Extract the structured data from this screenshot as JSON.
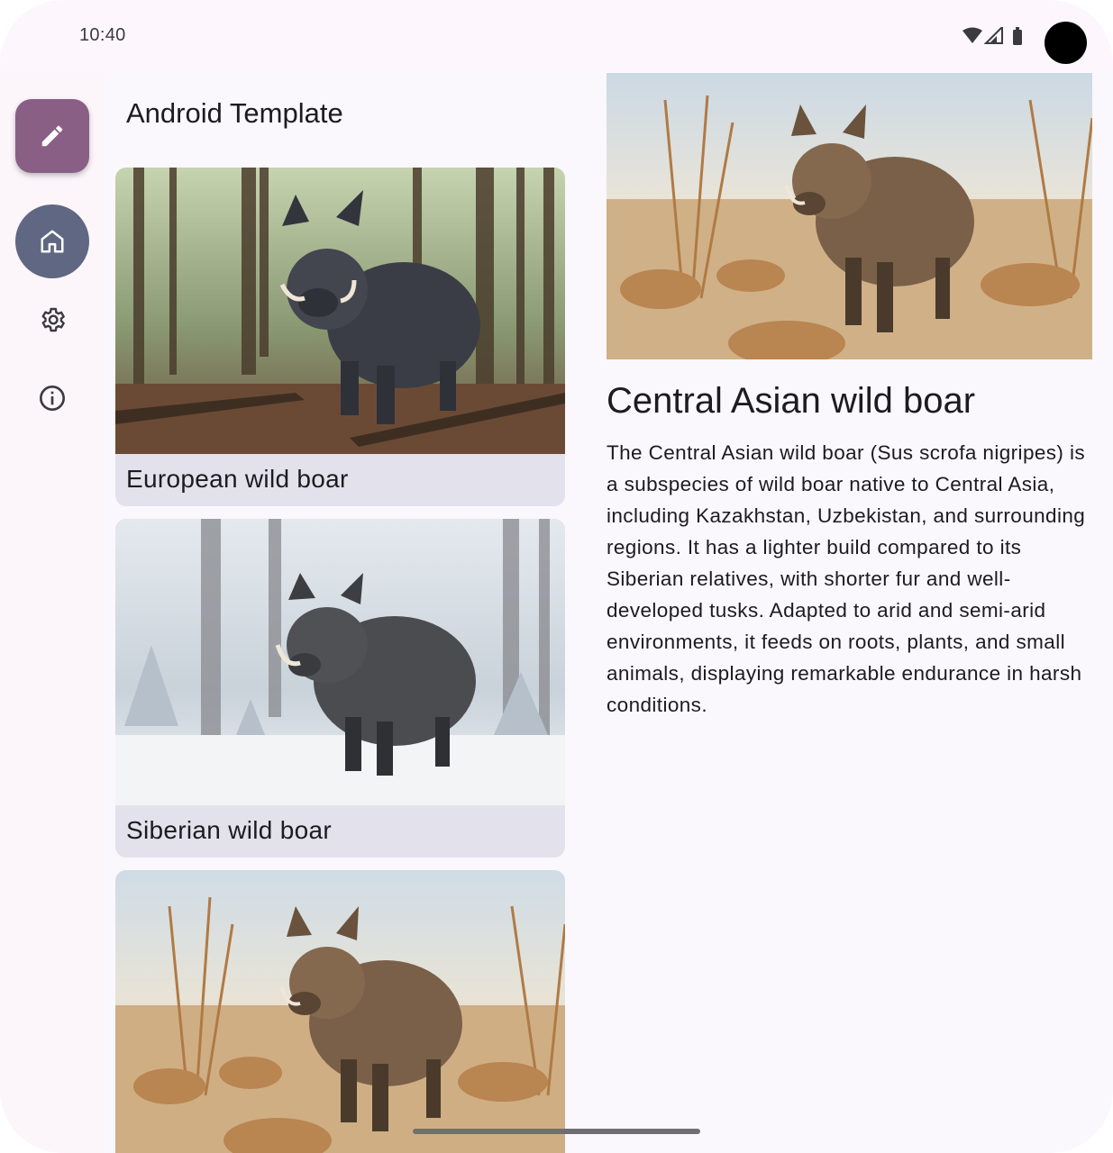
{
  "status_bar": {
    "time": "10:40",
    "icons": [
      "wifi-icon",
      "cell-signal-icon",
      "battery-icon"
    ]
  },
  "nav_rail": {
    "fab_icon": "edit-icon",
    "items": [
      {
        "icon": "home-icon",
        "selected": true
      },
      {
        "icon": "settings-gear-icon",
        "selected": false
      },
      {
        "icon": "info-icon",
        "selected": false
      }
    ]
  },
  "list": {
    "title": "Android Template",
    "items": [
      {
        "label": "European wild boar",
        "image": "boar-in-forest"
      },
      {
        "label": "Siberian wild boar",
        "image": "boar-in-snowy-forest"
      },
      {
        "label": "",
        "image": "boar-in-dry-steppe"
      }
    ]
  },
  "detail": {
    "image": "boar-in-dry-steppe",
    "title": "Central Asian wild boar",
    "description": "The Central Asian wild boar (Sus scrofa nigripes) is a subspecies of wild boar native to Central Asia, including Kazakhstan, Uzbekistan, and surrounding regions. It has a lighter build compared to its Siberian relatives, with shorter fur and well-developed tusks. Adapted to arid and semi-arid environments, it feeds on roots, plants, and small animals, displaying remarkable endurance in harsh conditions."
  },
  "colors": {
    "fab": "#8a5f86",
    "nav_selected": "#5f6782",
    "card_background": "#e3e2ec",
    "background": "#faf8fd"
  }
}
